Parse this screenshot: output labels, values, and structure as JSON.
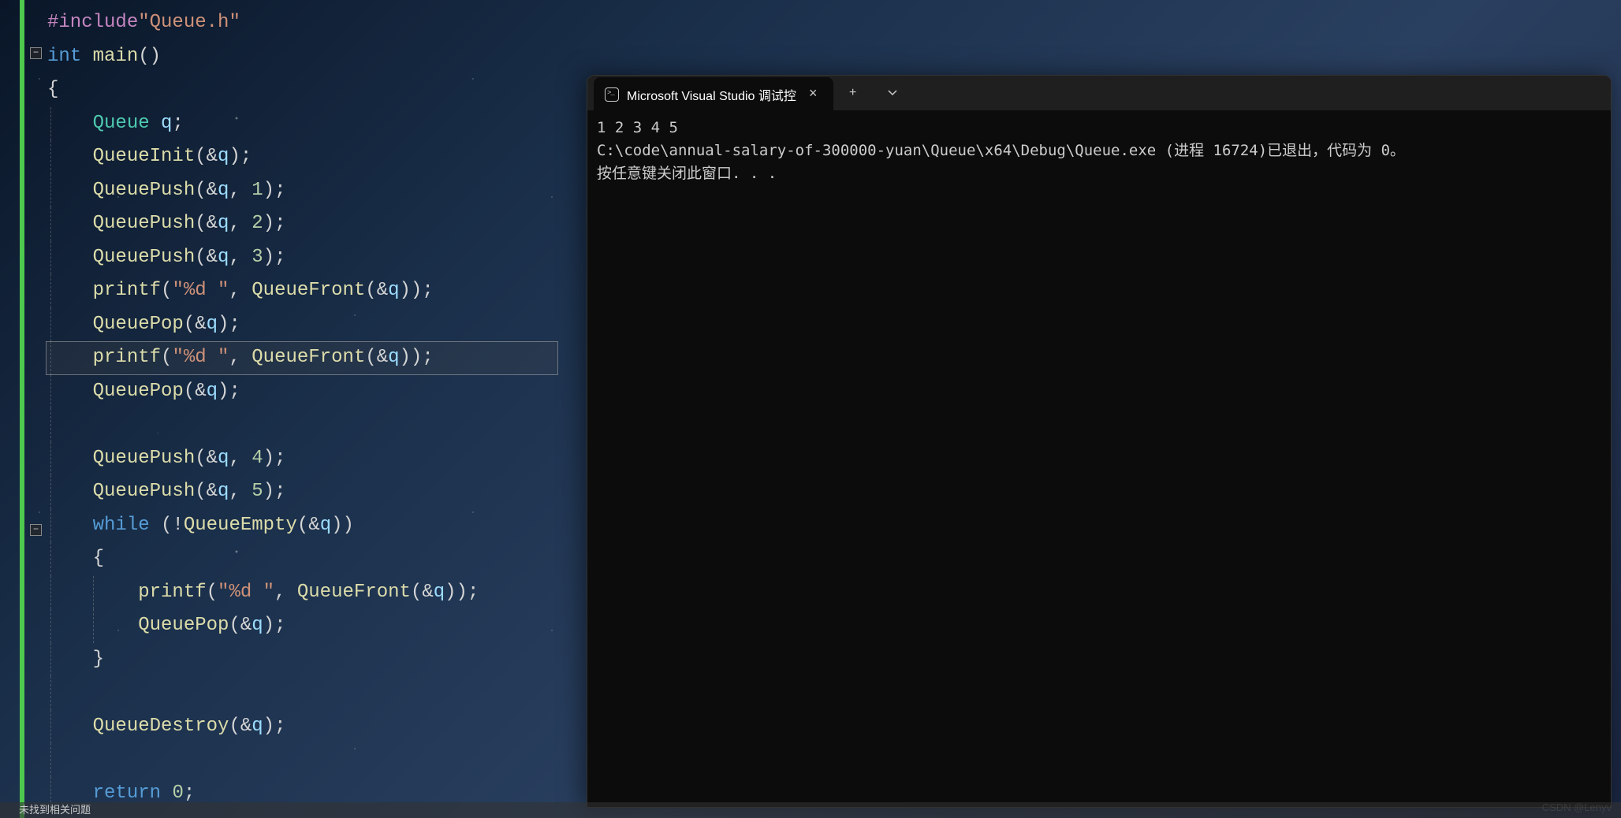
{
  "editor": {
    "lines": [
      {
        "indent": 0,
        "tokens": [
          {
            "cls": "preproc",
            "t": "#include"
          },
          {
            "cls": "string",
            "t": "\"Queue.h\""
          }
        ]
      },
      {
        "indent": 0,
        "fold": true,
        "foldTop": 60,
        "tokens": [
          {
            "cls": "keyword",
            "t": "int "
          },
          {
            "cls": "func",
            "t": "main"
          },
          {
            "cls": "paren",
            "t": "()"
          }
        ]
      },
      {
        "indent": 0,
        "tokens": [
          {
            "cls": "paren",
            "t": "{"
          }
        ]
      },
      {
        "indent": 1,
        "tokens": [
          {
            "cls": "type",
            "t": "Queue "
          },
          {
            "cls": "var",
            "t": "q"
          },
          {
            "cls": "punct",
            "t": ";"
          }
        ]
      },
      {
        "indent": 1,
        "tokens": [
          {
            "cls": "func",
            "t": "QueueInit"
          },
          {
            "cls": "paren",
            "t": "("
          },
          {
            "cls": "op",
            "t": "&"
          },
          {
            "cls": "var",
            "t": "q"
          },
          {
            "cls": "paren",
            "t": ")"
          },
          {
            "cls": "punct",
            "t": ";"
          }
        ]
      },
      {
        "indent": 1,
        "tokens": [
          {
            "cls": "func",
            "t": "QueuePush"
          },
          {
            "cls": "paren",
            "t": "("
          },
          {
            "cls": "op",
            "t": "&"
          },
          {
            "cls": "var",
            "t": "q"
          },
          {
            "cls": "punct",
            "t": ", "
          },
          {
            "cls": "number",
            "t": "1"
          },
          {
            "cls": "paren",
            "t": ")"
          },
          {
            "cls": "punct",
            "t": ";"
          }
        ]
      },
      {
        "indent": 1,
        "tokens": [
          {
            "cls": "func",
            "t": "QueuePush"
          },
          {
            "cls": "paren",
            "t": "("
          },
          {
            "cls": "op",
            "t": "&"
          },
          {
            "cls": "var",
            "t": "q"
          },
          {
            "cls": "punct",
            "t": ", "
          },
          {
            "cls": "number",
            "t": "2"
          },
          {
            "cls": "paren",
            "t": ")"
          },
          {
            "cls": "punct",
            "t": ";"
          }
        ]
      },
      {
        "indent": 1,
        "tokens": [
          {
            "cls": "func",
            "t": "QueuePush"
          },
          {
            "cls": "paren",
            "t": "("
          },
          {
            "cls": "op",
            "t": "&"
          },
          {
            "cls": "var",
            "t": "q"
          },
          {
            "cls": "punct",
            "t": ", "
          },
          {
            "cls": "number",
            "t": "3"
          },
          {
            "cls": "paren",
            "t": ")"
          },
          {
            "cls": "punct",
            "t": ";"
          }
        ]
      },
      {
        "indent": 1,
        "tokens": [
          {
            "cls": "func",
            "t": "printf"
          },
          {
            "cls": "paren",
            "t": "("
          },
          {
            "cls": "string",
            "t": "\"%d \""
          },
          {
            "cls": "punct",
            "t": ", "
          },
          {
            "cls": "func",
            "t": "QueueFront"
          },
          {
            "cls": "paren",
            "t": "("
          },
          {
            "cls": "op",
            "t": "&"
          },
          {
            "cls": "var",
            "t": "q"
          },
          {
            "cls": "paren",
            "t": "))"
          },
          {
            "cls": "punct",
            "t": ";"
          }
        ]
      },
      {
        "indent": 1,
        "tokens": [
          {
            "cls": "func",
            "t": "QueuePop"
          },
          {
            "cls": "paren",
            "t": "("
          },
          {
            "cls": "op",
            "t": "&"
          },
          {
            "cls": "var",
            "t": "q"
          },
          {
            "cls": "paren",
            "t": ")"
          },
          {
            "cls": "punct",
            "t": ";"
          }
        ]
      },
      {
        "indent": 1,
        "highlight": true,
        "tokens": [
          {
            "cls": "func",
            "t": "printf"
          },
          {
            "cls": "paren",
            "t": "("
          },
          {
            "cls": "string",
            "t": "\"%d \""
          },
          {
            "cls": "punct",
            "t": ", "
          },
          {
            "cls": "func",
            "t": "QueueFront"
          },
          {
            "cls": "paren",
            "t": "("
          },
          {
            "cls": "op",
            "t": "&"
          },
          {
            "cls": "var",
            "t": "q"
          },
          {
            "cls": "paren",
            "t": "))"
          },
          {
            "cls": "punct",
            "t": ";"
          }
        ]
      },
      {
        "indent": 1,
        "tokens": [
          {
            "cls": "func",
            "t": "QueuePop"
          },
          {
            "cls": "paren",
            "t": "("
          },
          {
            "cls": "op",
            "t": "&"
          },
          {
            "cls": "var",
            "t": "q"
          },
          {
            "cls": "paren",
            "t": ")"
          },
          {
            "cls": "punct",
            "t": ";"
          }
        ]
      },
      {
        "indent": 1,
        "tokens": []
      },
      {
        "indent": 1,
        "tokens": [
          {
            "cls": "func",
            "t": "QueuePush"
          },
          {
            "cls": "paren",
            "t": "("
          },
          {
            "cls": "op",
            "t": "&"
          },
          {
            "cls": "var",
            "t": "q"
          },
          {
            "cls": "punct",
            "t": ", "
          },
          {
            "cls": "number",
            "t": "4"
          },
          {
            "cls": "paren",
            "t": ")"
          },
          {
            "cls": "punct",
            "t": ";"
          }
        ]
      },
      {
        "indent": 1,
        "tokens": [
          {
            "cls": "func",
            "t": "QueuePush"
          },
          {
            "cls": "paren",
            "t": "("
          },
          {
            "cls": "op",
            "t": "&"
          },
          {
            "cls": "var",
            "t": "q"
          },
          {
            "cls": "punct",
            "t": ", "
          },
          {
            "cls": "number",
            "t": "5"
          },
          {
            "cls": "paren",
            "t": ")"
          },
          {
            "cls": "punct",
            "t": ";"
          }
        ]
      },
      {
        "indent": 1,
        "fold": true,
        "foldTop": 665,
        "tokens": [
          {
            "cls": "keyword",
            "t": "while "
          },
          {
            "cls": "paren",
            "t": "("
          },
          {
            "cls": "op",
            "t": "!"
          },
          {
            "cls": "func",
            "t": "QueueEmpty"
          },
          {
            "cls": "paren",
            "t": "("
          },
          {
            "cls": "op",
            "t": "&"
          },
          {
            "cls": "var",
            "t": "q"
          },
          {
            "cls": "paren",
            "t": "))"
          }
        ]
      },
      {
        "indent": 1,
        "tokens": [
          {
            "cls": "paren",
            "t": "{"
          }
        ]
      },
      {
        "indent": 2,
        "tokens": [
          {
            "cls": "func",
            "t": "printf"
          },
          {
            "cls": "paren",
            "t": "("
          },
          {
            "cls": "string",
            "t": "\"%d \""
          },
          {
            "cls": "punct",
            "t": ", "
          },
          {
            "cls": "func",
            "t": "QueueFront"
          },
          {
            "cls": "paren",
            "t": "("
          },
          {
            "cls": "op",
            "t": "&"
          },
          {
            "cls": "var",
            "t": "q"
          },
          {
            "cls": "paren",
            "t": "))"
          },
          {
            "cls": "punct",
            "t": ";"
          }
        ]
      },
      {
        "indent": 2,
        "tokens": [
          {
            "cls": "func",
            "t": "QueuePop"
          },
          {
            "cls": "paren",
            "t": "("
          },
          {
            "cls": "op",
            "t": "&"
          },
          {
            "cls": "var",
            "t": "q"
          },
          {
            "cls": "paren",
            "t": ")"
          },
          {
            "cls": "punct",
            "t": ";"
          }
        ]
      },
      {
        "indent": 1,
        "tokens": [
          {
            "cls": "paren",
            "t": "}"
          }
        ]
      },
      {
        "indent": 1,
        "tokens": []
      },
      {
        "indent": 1,
        "tokens": [
          {
            "cls": "func",
            "t": "QueueDestroy"
          },
          {
            "cls": "paren",
            "t": "("
          },
          {
            "cls": "op",
            "t": "&"
          },
          {
            "cls": "var",
            "t": "q"
          },
          {
            "cls": "paren",
            "t": ")"
          },
          {
            "cls": "punct",
            "t": ";"
          }
        ]
      },
      {
        "indent": 1,
        "tokens": []
      },
      {
        "indent": 1,
        "tokens": [
          {
            "cls": "keyword",
            "t": "return "
          },
          {
            "cls": "number",
            "t": "0"
          },
          {
            "cls": "punct",
            "t": ";"
          }
        ]
      }
    ]
  },
  "console": {
    "tab_title": "Microsoft Visual Studio 调试控",
    "output_line1": "1 2 3 4 5",
    "output_line2": "C:\\code\\annual-salary-of-300000-yuan\\Queue\\x64\\Debug\\Queue.exe (进程 16724)已退出，代码为 0。",
    "output_line3": "按任意键关闭此窗口. . ."
  },
  "watermark": "CSDN @Lenyv",
  "bottom_bar": "未找到相关问题"
}
